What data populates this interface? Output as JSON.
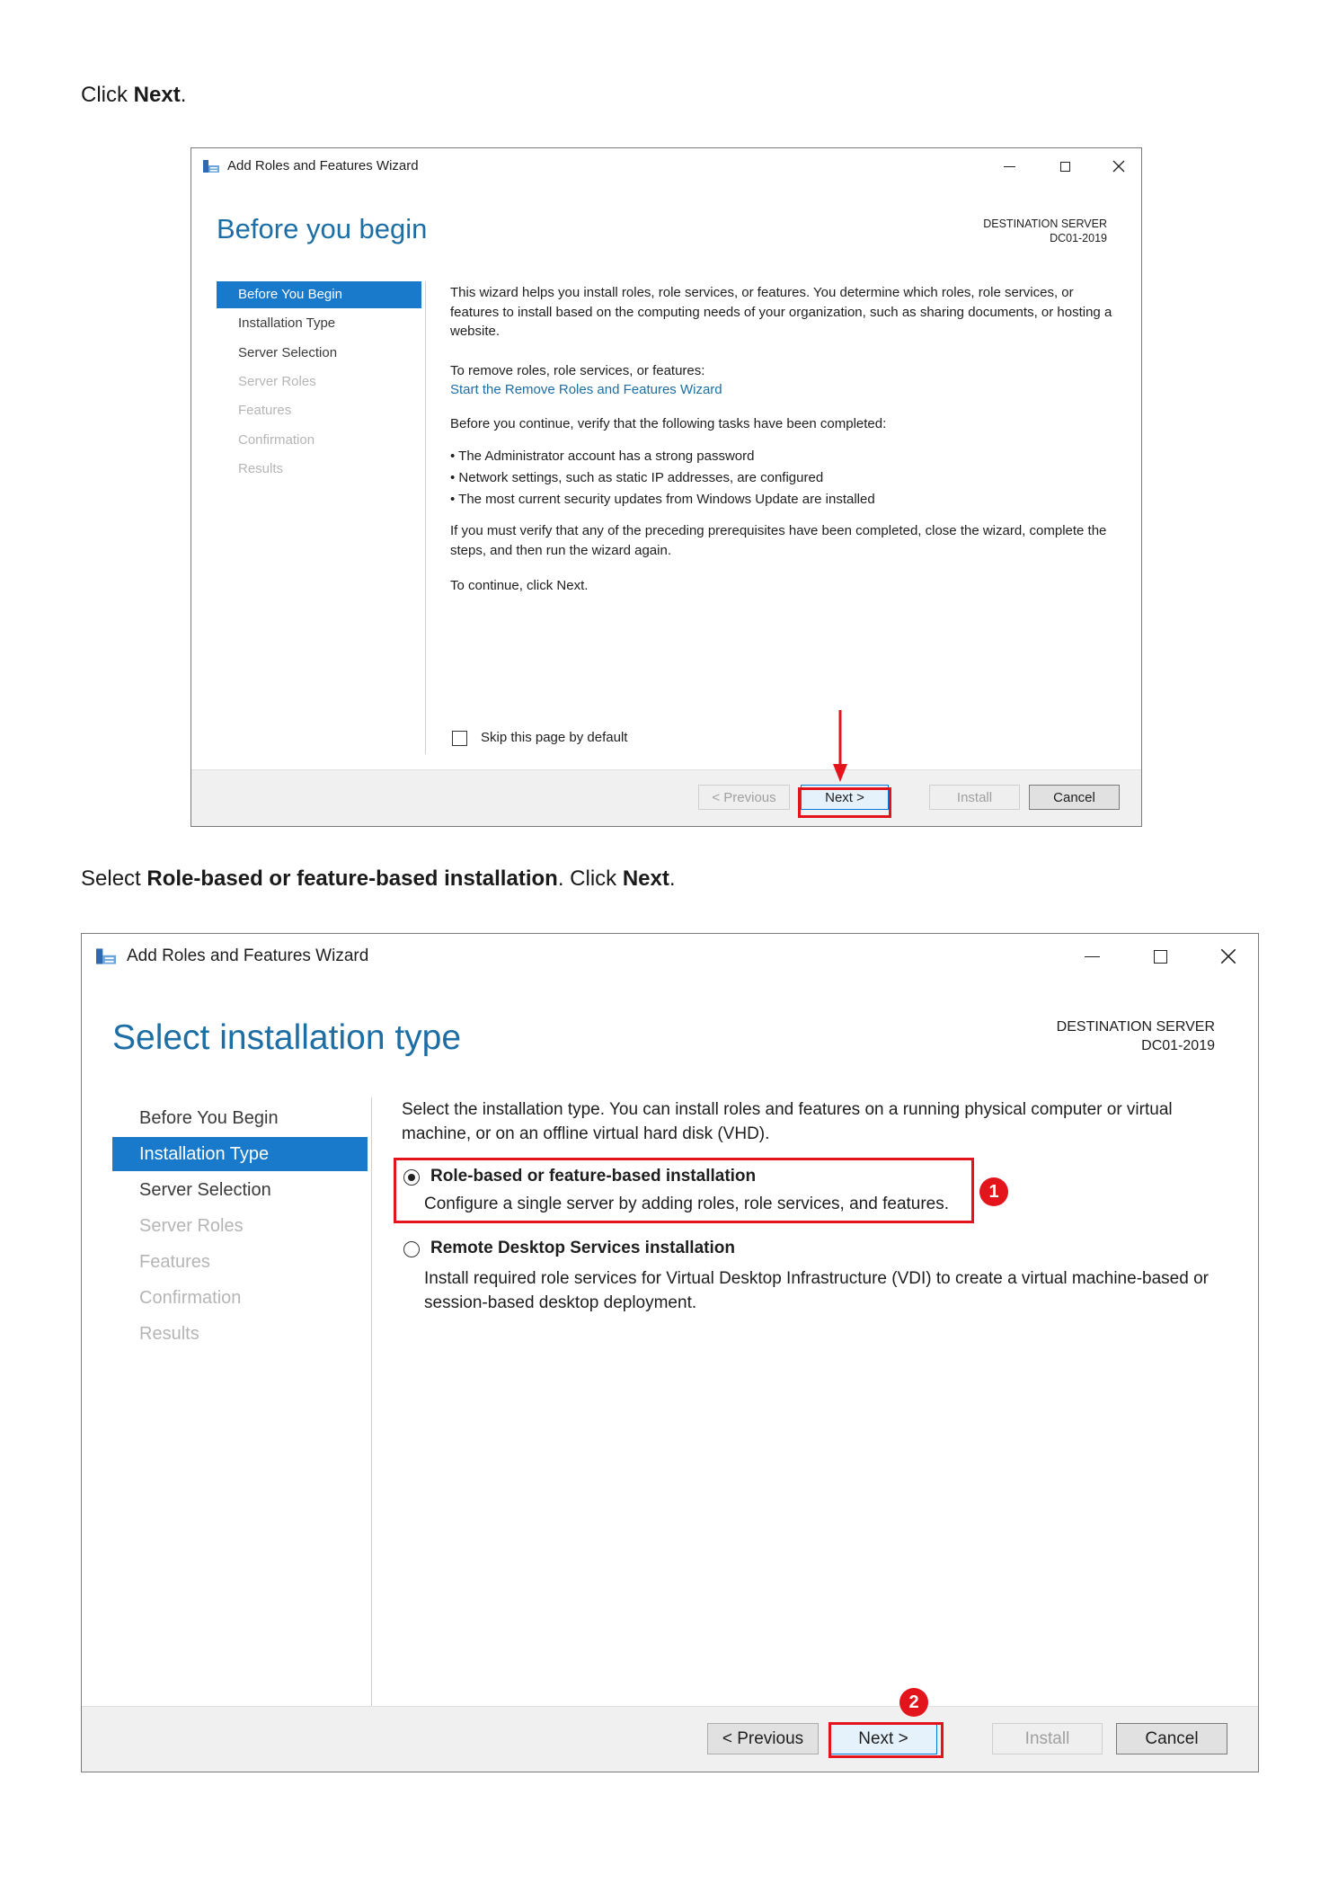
{
  "step1": {
    "instruction": {
      "prefix": "Click ",
      "bold": "Next",
      "suffix": "."
    },
    "window": {
      "title": "Add Roles and Features Wizard",
      "heading": "Before you begin",
      "destination_label": "DESTINATION SERVER",
      "destination_server": "DC01-2019",
      "nav": [
        {
          "label": "Before You Begin",
          "state": "active"
        },
        {
          "label": "Installation Type",
          "state": "enabled"
        },
        {
          "label": "Server Selection",
          "state": "enabled"
        },
        {
          "label": "Server Roles",
          "state": "disabled"
        },
        {
          "label": "Features",
          "state": "disabled"
        },
        {
          "label": "Confirmation",
          "state": "disabled"
        },
        {
          "label": "Results",
          "state": "disabled"
        }
      ],
      "content": {
        "intro": "This wizard helps you install roles, role services, or features. You determine which roles, role services, or features to install based on the computing needs of your organization, such as sharing documents, or hosting a website.",
        "remove_label": "To remove roles, role services, or features:",
        "remove_link": "Start the Remove Roles and Features Wizard",
        "verify": "Before you continue, verify that the following tasks have been completed:",
        "bullets": [
          "The Administrator account has a strong password",
          "Network settings, such as static IP addresses, are configured",
          "The most current security updates from Windows Update are installed"
        ],
        "prereq": "If you must verify that any of the preceding prerequisites have been completed, close the wizard, complete the steps, and then run the wizard again.",
        "continue": "To continue, click Next.",
        "skip_label": "Skip this page by default"
      },
      "buttons": {
        "previous": "< Previous",
        "next": "Next >",
        "install": "Install",
        "cancel": "Cancel"
      }
    }
  },
  "step2": {
    "instruction": {
      "prefix": "Select ",
      "bold1": "Role-based or feature-based installation",
      "middle": ". Click ",
      "bold2": "Next",
      "suffix": "."
    },
    "window": {
      "title": "Add Roles and Features Wizard",
      "heading": "Select installation type",
      "destination_label": "DESTINATION SERVER",
      "destination_server": "DC01-2019",
      "nav": [
        {
          "label": "Before You Begin",
          "state": "enabled"
        },
        {
          "label": "Installation Type",
          "state": "active"
        },
        {
          "label": "Server Selection",
          "state": "enabled"
        },
        {
          "label": "Server Roles",
          "state": "disabled"
        },
        {
          "label": "Features",
          "state": "disabled"
        },
        {
          "label": "Confirmation",
          "state": "disabled"
        },
        {
          "label": "Results",
          "state": "disabled"
        }
      ],
      "content": {
        "intro": "Select the installation type. You can install roles and features on a running physical computer or virtual machine, or on an offline virtual hard disk (VHD).",
        "option1_title": "Role-based or feature-based installation",
        "option1_desc": "Configure a single server by adding roles, role services, and features.",
        "option2_title": "Remote Desktop Services installation",
        "option2_desc": "Install required role services for Virtual Desktop Infrastructure (VDI) to create a virtual machine-based or session-based desktop deployment."
      },
      "buttons": {
        "previous": "< Previous",
        "next": "Next >",
        "install": "Install",
        "cancel": "Cancel"
      },
      "badges": [
        "1",
        "2"
      ]
    }
  },
  "colors": {
    "accent": "#1979ca",
    "heading": "#1c6ea4",
    "highlight": "#e3141b"
  }
}
